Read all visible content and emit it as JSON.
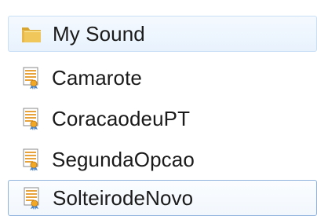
{
  "items": [
    {
      "label": "My Sound",
      "icon": "folder-icon",
      "state": "hover"
    },
    {
      "label": "Camarote",
      "icon": "media-file-icon",
      "state": "normal"
    },
    {
      "label": "CoracaodeuPT",
      "icon": "media-file-icon",
      "state": "normal"
    },
    {
      "label": "SegundaOpcao",
      "icon": "media-file-icon",
      "state": "normal"
    },
    {
      "label": "SolteirodeNovo",
      "icon": "media-file-icon",
      "state": "focused"
    }
  ]
}
